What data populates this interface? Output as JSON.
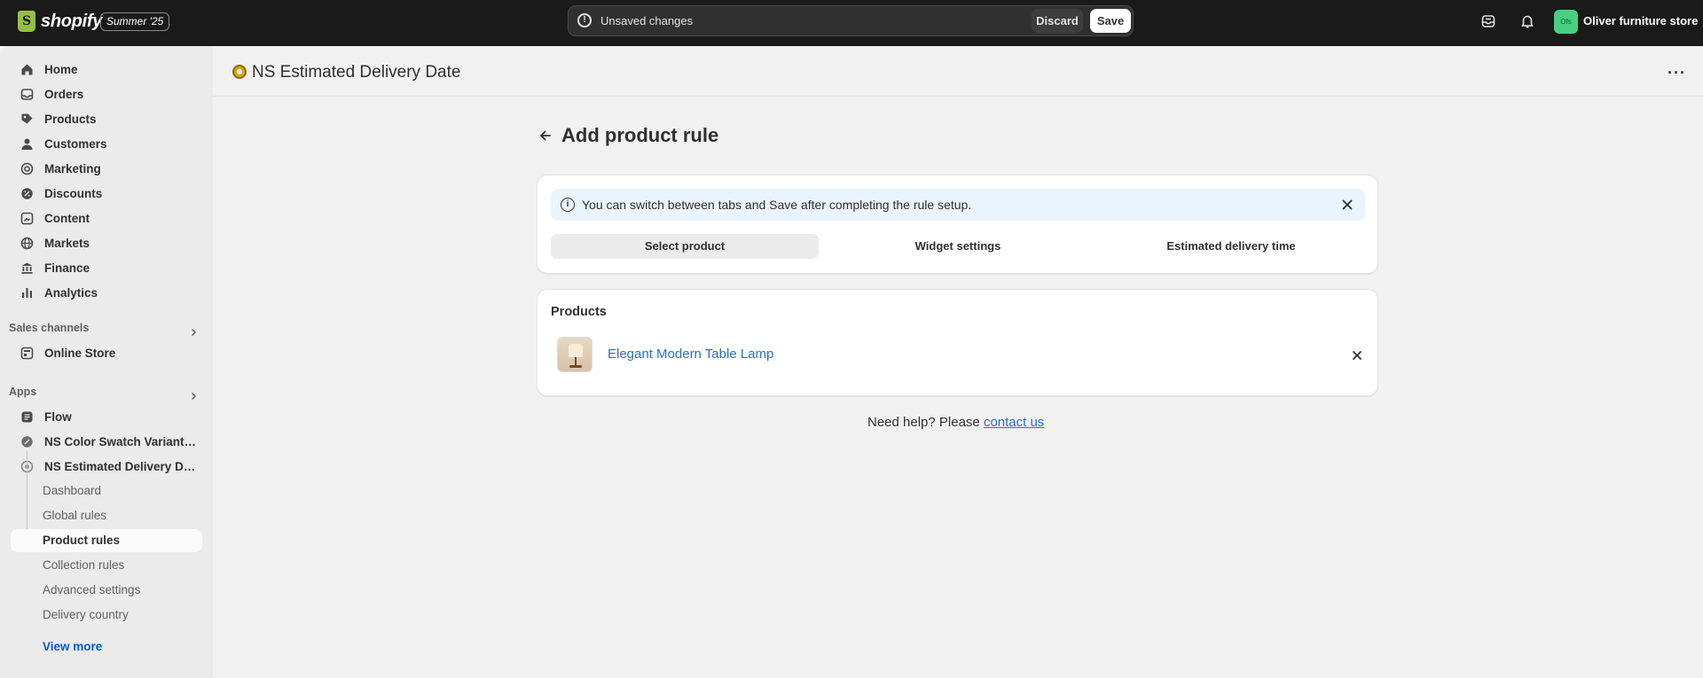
{
  "topbar": {
    "logo_text": "shopify",
    "edition_badge": "Summer '25",
    "unsaved_text": "Unsaved changes",
    "discard_label": "Discard",
    "save_label": "Save",
    "avatar_initials": "Ofs",
    "store_name": "Oliver furniture store"
  },
  "sidebar": {
    "main_items": [
      {
        "label": "Home",
        "icon": "home-icon"
      },
      {
        "label": "Orders",
        "icon": "orders-icon"
      },
      {
        "label": "Products",
        "icon": "tag-icon"
      },
      {
        "label": "Customers",
        "icon": "person-icon"
      },
      {
        "label": "Marketing",
        "icon": "target-icon"
      },
      {
        "label": "Discounts",
        "icon": "discount-icon"
      },
      {
        "label": "Content",
        "icon": "content-icon"
      },
      {
        "label": "Markets",
        "icon": "globe-icon"
      },
      {
        "label": "Finance",
        "icon": "bank-icon"
      },
      {
        "label": "Analytics",
        "icon": "bar-chart-icon"
      }
    ],
    "sales_channels_title": "Sales channels",
    "online_store_label": "Online Store",
    "apps_title": "Apps",
    "apps": [
      {
        "label": "Flow"
      },
      {
        "label": "NS Color Swatch Variant I..."
      },
      {
        "label": "NS Estimated Delivery Date"
      }
    ],
    "sub_items": [
      {
        "label": "Dashboard",
        "active": false
      },
      {
        "label": "Global rules",
        "active": false
      },
      {
        "label": "Product rules",
        "active": true
      },
      {
        "label": "Collection rules",
        "active": false
      },
      {
        "label": "Advanced settings",
        "active": false
      },
      {
        "label": "Delivery country",
        "active": false
      }
    ],
    "view_more_label": "View more"
  },
  "app_header": {
    "title": "NS Estimated Delivery Date"
  },
  "page": {
    "title": "Add product rule",
    "banner_text": "You can switch between tabs and Save after completing the rule setup.",
    "tabs": [
      {
        "label": "Select product",
        "active": true
      },
      {
        "label": "Widget settings",
        "active": false
      },
      {
        "label": "Estimated delivery time",
        "active": false
      }
    ],
    "products_heading": "Products",
    "product_name": "Elegant Modern Table Lamp",
    "help_text": "Need help? Please ",
    "help_link": "contact us"
  },
  "colors": {
    "topbar_bg": "#1a1a1a",
    "sidebar_bg": "#ebebeb",
    "page_bg": "#f1f1f1",
    "link": "#2c6ecb",
    "banner_bg": "#eaf4ff"
  }
}
